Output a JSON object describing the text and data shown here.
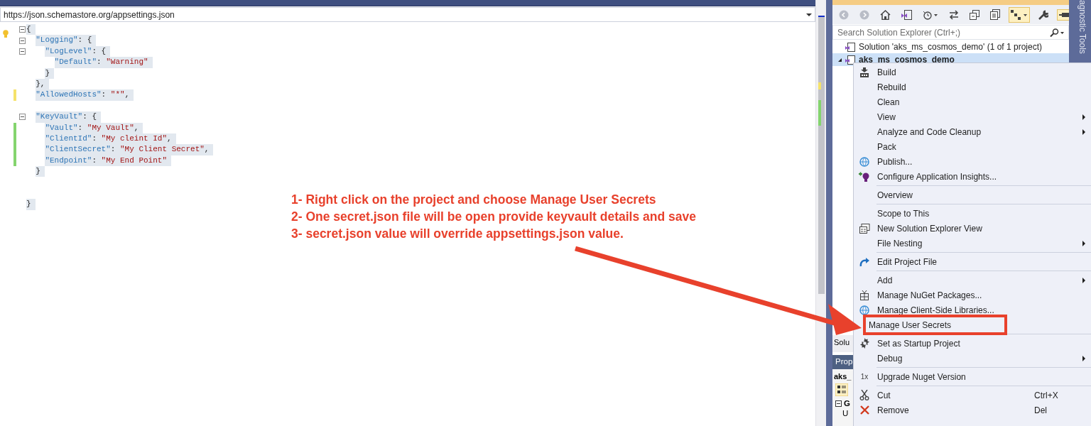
{
  "editor": {
    "navigation_path": "https://json.schemastore.org/appsettings.json",
    "lines": [
      {
        "kind": "code",
        "tokens": [
          {
            "kind": "punct",
            "text": "{"
          }
        ],
        "children": [
          {
            "kind": "code",
            "tokens": [
              {
                "kind": "key",
                "text": "\"Logging\""
              },
              {
                "kind": "punct",
                "text": ": {"
              }
            ],
            "children": [
              {
                "kind": "code",
                "tokens": [
                  {
                    "kind": "key",
                    "text": "\"LogLevel\""
                  },
                  {
                    "kind": "punct",
                    "text": ": {"
                  }
                ],
                "children": [
                  {
                    "kind": "code",
                    "tokens": [
                      {
                        "kind": "key",
                        "text": "\"Default\""
                      },
                      {
                        "kind": "punct",
                        "text": ": "
                      },
                      {
                        "kind": "string",
                        "text": "\"Warning\""
                      }
                    ]
                  }
                ]
              },
              {
                "kind": "code",
                "tokens": [
                  {
                    "kind": "punct",
                    "text": "}"
                  }
                ]
              }
            ]
          },
          {
            "kind": "code",
            "tokens": [
              {
                "kind": "punct",
                "text": "},"
              }
            ]
          },
          {
            "kind": "code",
            "color": "#f5e26a",
            "tokens": [
              {
                "kind": "key",
                "text": "\"AllowedHosts\""
              },
              {
                "kind": "punct",
                "text": ": "
              },
              {
                "kind": "string",
                "text": "\"*\""
              },
              {
                "kind": "punct",
                "text": ","
              }
            ]
          },
          {
            "kind": "blank"
          },
          {
            "kind": "code",
            "tokens": [
              {
                "kind": "key",
                "text": "\"KeyVault\""
              },
              {
                "kind": "punct",
                "text": ": {"
              }
            ],
            "children": [
              {
                "kind": "code",
                "color": "#84d46e",
                "tokens": [
                  {
                    "kind": "key",
                    "text": "\"Vault\""
                  },
                  {
                    "kind": "punct",
                    "text": ": "
                  },
                  {
                    "kind": "string",
                    "text": "\"My Vault\""
                  },
                  {
                    "kind": "punct",
                    "text": ","
                  }
                ]
              },
              {
                "kind": "code",
                "color": "#84d46e",
                "tokens": [
                  {
                    "kind": "key",
                    "text": "\"ClientId\""
                  },
                  {
                    "kind": "punct",
                    "text": ": "
                  },
                  {
                    "kind": "string",
                    "text": "\"My cleint Id\""
                  },
                  {
                    "kind": "punct",
                    "text": ","
                  }
                ]
              },
              {
                "kind": "code",
                "color": "#84d46e",
                "tokens": [
                  {
                    "kind": "key",
                    "text": "\"ClientSecret\""
                  },
                  {
                    "kind": "punct",
                    "text": ": "
                  },
                  {
                    "kind": "string",
                    "text": "\"My Client Secret\""
                  },
                  {
                    "kind": "punct",
                    "text": ","
                  }
                ]
              },
              {
                "kind": "code",
                "color": "#84d46e",
                "tokens": [
                  {
                    "kind": "key",
                    "text": "\"Endpoint\""
                  },
                  {
                    "kind": "punct",
                    "text": ": "
                  },
                  {
                    "kind": "string",
                    "text": "\"My End Point\""
                  }
                ]
              }
            ]
          },
          {
            "kind": "code",
            "tokens": [
              {
                "kind": "punct",
                "text": "}"
              }
            ]
          },
          {
            "kind": "blank"
          },
          {
            "kind": "blank"
          }
        ]
      },
      {
        "kind": "code",
        "tokens": [
          {
            "kind": "punct",
            "text": "}"
          }
        ]
      }
    ]
  },
  "annotation": {
    "lines": [
      "1- Right click on the project and choose Manage User Secrets",
      "2- One secret.json file will be open provide keyvault details and save",
      "3- secret.json value will override appsettings.json value."
    ]
  },
  "solution_explorer": {
    "toolbar": [
      {
        "disabled": true,
        "on": false
      },
      {
        "disabled": true,
        "on": false
      },
      {
        "disabled": false,
        "on": false
      },
      {
        "disabled": false,
        "on": false
      },
      {
        "disabled": false,
        "on": false
      },
      {
        "disabled": false,
        "on": false
      },
      {
        "disabled": false,
        "on": false
      },
      {
        "disabled": false,
        "on": false
      },
      {
        "disabled": false,
        "on": true
      },
      {
        "disabled": false,
        "on": false
      },
      {
        "disabled": false,
        "on": true
      }
    ],
    "search": {
      "placeholder": "Search Solution Explorer (Ctrl+;)"
    },
    "tree": [
      {
        "label": "Solution 'aks_ms_cosmos_demo' (1 of 1 project)",
        "selected": false,
        "children": [
          {
            "label": "aks_ms_cosmos_demo",
            "selected": true,
            "expanded": true
          }
        ]
      }
    ],
    "bottom_tab": "Solu"
  },
  "properties": {
    "title": "Prop",
    "object": "aks_",
    "category": "G",
    "row": "U"
  },
  "diagnostic_tab": "agnostic Tools",
  "context_menu": {
    "items": [
      {
        "kind": "item",
        "label": "Build",
        "submenu": false
      },
      {
        "kind": "item",
        "label": "Rebuild",
        "submenu": false
      },
      {
        "kind": "item",
        "label": "Clean",
        "submenu": false
      },
      {
        "kind": "item",
        "label": "View",
        "submenu": true
      },
      {
        "kind": "item",
        "label": "Analyze and Code Cleanup",
        "submenu": true
      },
      {
        "kind": "item",
        "label": "Pack",
        "submenu": false
      },
      {
        "kind": "item",
        "label": "Publish...",
        "submenu": false
      },
      {
        "kind": "item",
        "label": "Configure Application Insights...",
        "submenu": false
      },
      {
        "kind": "separator"
      },
      {
        "kind": "item",
        "label": "Overview",
        "submenu": false
      },
      {
        "kind": "separator"
      },
      {
        "kind": "item",
        "label": "Scope to This",
        "submenu": false
      },
      {
        "kind": "item",
        "label": "New Solution Explorer View",
        "submenu": false
      },
      {
        "kind": "item",
        "label": "File Nesting",
        "submenu": true
      },
      {
        "kind": "separator"
      },
      {
        "kind": "item",
        "label": "Edit Project File",
        "submenu": false
      },
      {
        "kind": "separator"
      },
      {
        "kind": "item",
        "label": "Add",
        "submenu": true
      },
      {
        "kind": "item",
        "label": "Manage NuGet Packages...",
        "submenu": false
      },
      {
        "kind": "item",
        "label": "Manage Client-Side Libraries...",
        "submenu": false
      },
      {
        "kind": "item",
        "label": "Manage User Secrets",
        "submenu": false,
        "highlighted": true
      },
      {
        "kind": "separator"
      },
      {
        "kind": "item",
        "label": "Set as Startup Project",
        "submenu": false
      },
      {
        "kind": "item",
        "label": "Debug",
        "submenu": true
      },
      {
        "kind": "separator"
      },
      {
        "kind": "item",
        "label": "Upgrade Nuget Version",
        "badge": "1x",
        "submenu": false
      },
      {
        "kind": "separator"
      },
      {
        "kind": "item",
        "label": "Cut",
        "shortcut": "Ctrl+X",
        "submenu": false
      },
      {
        "kind": "item",
        "label": "Remove",
        "shortcut": "Del",
        "submenu": false
      }
    ]
  }
}
